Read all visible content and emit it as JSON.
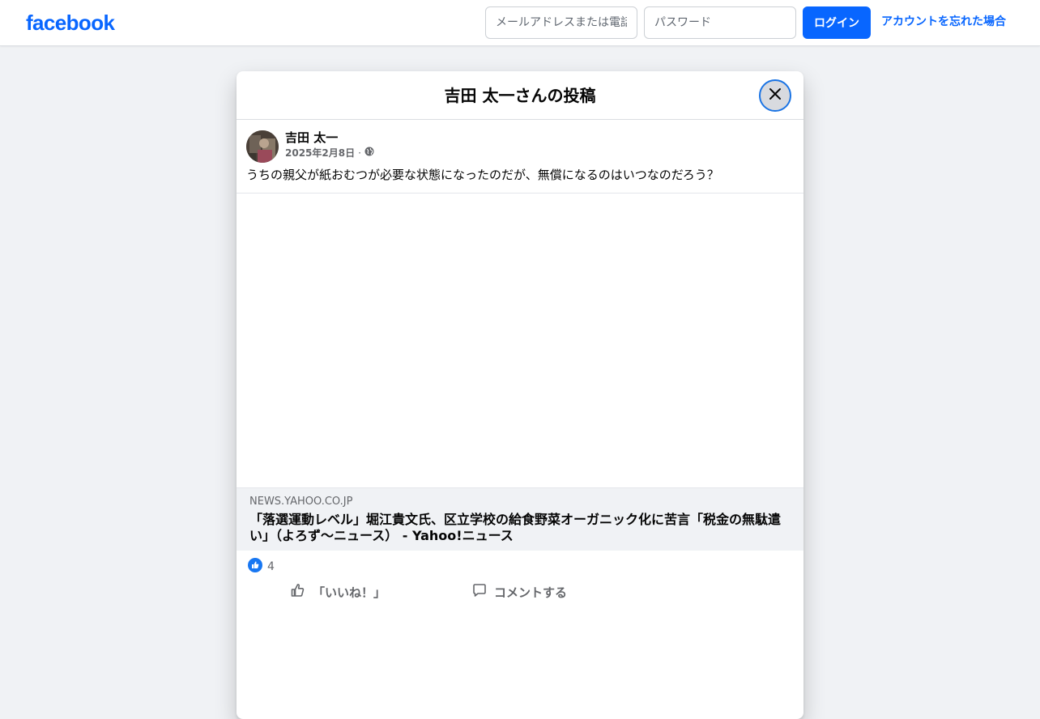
{
  "header": {
    "logo_text": "facebook",
    "email_placeholder": "メールアドレスまたは電話番号",
    "password_placeholder": "パスワード",
    "login_label": "ログイン",
    "forgot_label": "アカウントを忘れた場合"
  },
  "modal": {
    "title": "吉田 太一さんの投稿"
  },
  "post": {
    "author": "吉田 太一",
    "date": "2025年2月8日",
    "separator": "·",
    "text": "うちの親父が紙おむつが必要な状態になったのだが、無償になるのはいつなのだろう？",
    "link": {
      "domain": "NEWS.YAHOO.CO.JP",
      "title": "「落選運動レベル」堀江貴文氏、区立学校の給食野菜オーガニック化に苦言「税金の無駄遣い」（よろず〜ニュース） - Yahoo!ニュース"
    },
    "reaction_count": "4",
    "actions": {
      "like_label": "「いいね！」",
      "comment_label": "コメントする"
    }
  },
  "colors": {
    "brand": "#0866ff",
    "page_bg": "#f0f2f5"
  }
}
